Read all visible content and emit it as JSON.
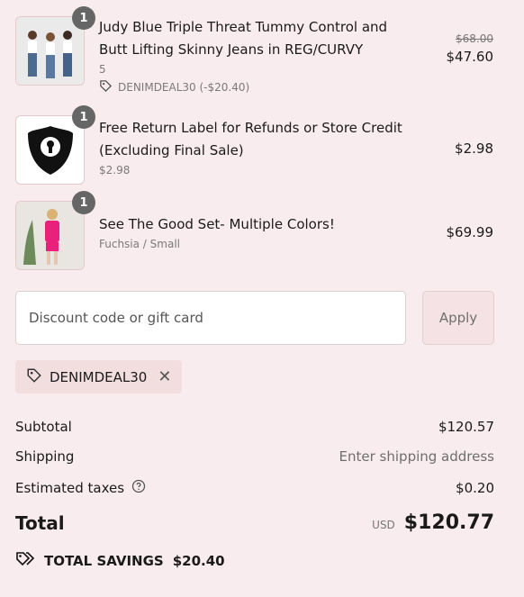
{
  "items": [
    {
      "quantity": "1",
      "title": "Judy Blue Triple Threat Tummy Control and Butt Lifting Skinny Jeans in REG/CURVY",
      "variant": "5",
      "discount": "DENIMDEAL30 (-$20.40)",
      "compare_price": "$68.00",
      "price": "$47.60"
    },
    {
      "quantity": "1",
      "title": "Free Return Label for Refunds or Store Credit (Excluding Final Sale)",
      "variant": "$2.98",
      "price": "$2.98"
    },
    {
      "quantity": "1",
      "title": "See The Good Set- Multiple Colors!",
      "variant": "Fuchsia / Small",
      "price": "$69.99"
    }
  ],
  "discount": {
    "placeholder": "Discount code or gift card",
    "apply_label": "Apply",
    "applied_code": "DENIMDEAL30"
  },
  "summary": {
    "subtotal_label": "Subtotal",
    "subtotal_value": "$120.57",
    "shipping_label": "Shipping",
    "shipping_value": "Enter shipping address",
    "taxes_label": "Estimated taxes",
    "taxes_value": "$0.20",
    "total_label": "Total",
    "currency": "USD",
    "total_value": "$120.77",
    "savings_label": "TOTAL SAVINGS",
    "savings_value": "$20.40"
  },
  "icons": {
    "tag": "tag-icon",
    "close": "close-icon",
    "help": "help-circle-icon",
    "savings": "savings-tag-icon"
  },
  "colors": {
    "background": "#f9ecee",
    "badge": "#666666",
    "chip": "#f3dedf",
    "apply_button": "#f5e2e4"
  }
}
